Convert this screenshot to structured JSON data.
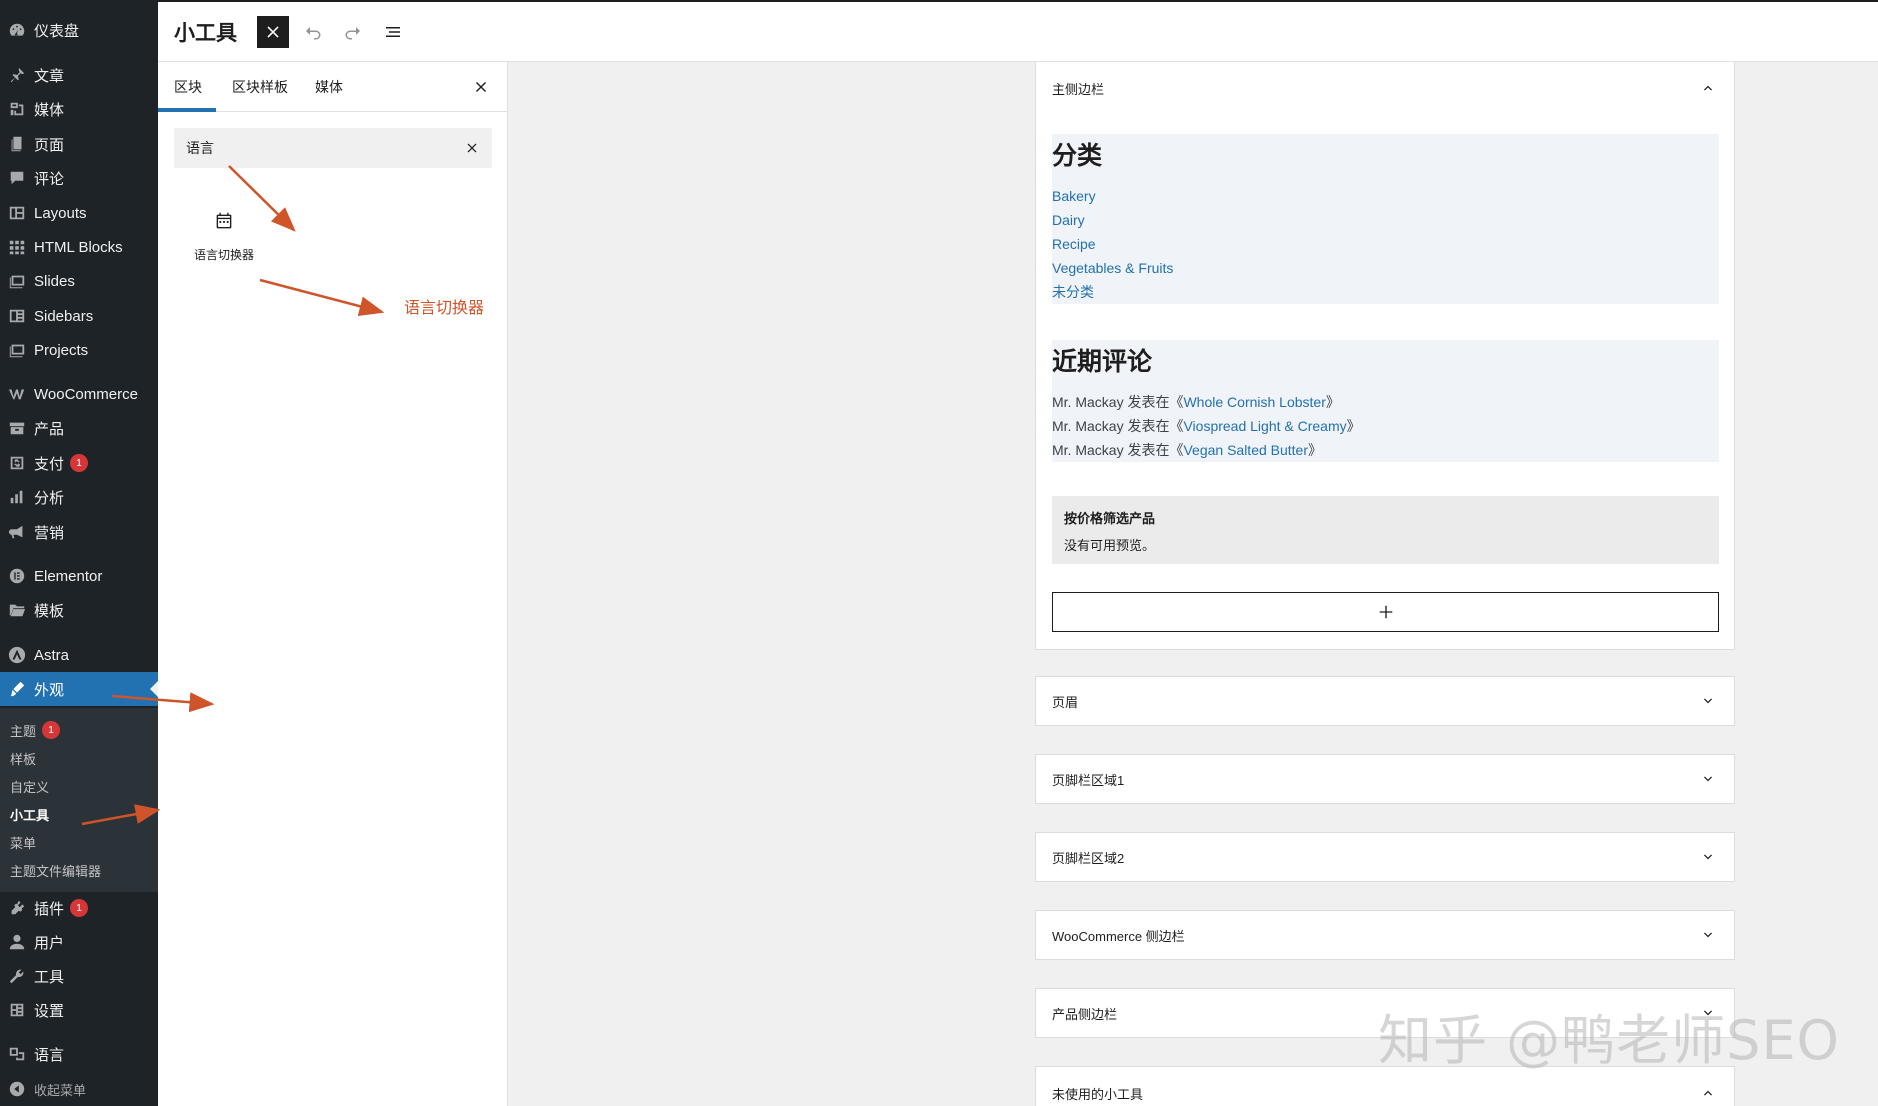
{
  "admin_menu": {
    "items": [
      {
        "key": "dashboard",
        "label": "仪表盘",
        "icon": "dashboard-icon"
      },
      {
        "key": "posts",
        "label": "文章",
        "icon": "pin-icon"
      },
      {
        "key": "media",
        "label": "媒体",
        "icon": "media-icon"
      },
      {
        "key": "pages",
        "label": "页面",
        "icon": "page-icon"
      },
      {
        "key": "comments",
        "label": "评论",
        "icon": "comment-icon"
      },
      {
        "key": "layouts",
        "label": "Layouts",
        "icon": "layouts-icon"
      },
      {
        "key": "html_blocks",
        "label": "HTML Blocks",
        "icon": "grid-icon"
      },
      {
        "key": "slides",
        "label": "Slides",
        "icon": "slides-icon"
      },
      {
        "key": "sidebars",
        "label": "Sidebars",
        "icon": "sidebars-icon"
      },
      {
        "key": "projects",
        "label": "Projects",
        "icon": "projects-icon"
      },
      {
        "key": "woocommerce",
        "label": "WooCommerce",
        "icon": "woocommerce-icon"
      },
      {
        "key": "products",
        "label": "产品",
        "icon": "archive-icon"
      },
      {
        "key": "payments",
        "label": "支付",
        "icon": "payment-icon",
        "badge": "1"
      },
      {
        "key": "analytics",
        "label": "分析",
        "icon": "chart-icon"
      },
      {
        "key": "marketing",
        "label": "营销",
        "icon": "megaphone-icon"
      },
      {
        "key": "elementor",
        "label": "Elementor",
        "icon": "elementor-icon"
      },
      {
        "key": "templates",
        "label": "模板",
        "icon": "folder-icon"
      },
      {
        "key": "astra",
        "label": "Astra",
        "icon": "astra-icon"
      },
      {
        "key": "appearance",
        "label": "外观",
        "icon": "brush-icon"
      },
      {
        "key": "plugins",
        "label": "插件",
        "icon": "plugin-icon",
        "badge": "1"
      },
      {
        "key": "users",
        "label": "用户",
        "icon": "user-icon"
      },
      {
        "key": "tools",
        "label": "工具",
        "icon": "wrench-icon"
      },
      {
        "key": "settings",
        "label": "设置",
        "icon": "settings-icon"
      },
      {
        "key": "languages",
        "label": "语言",
        "icon": "translation-icon"
      },
      {
        "key": "collapse",
        "label": "收起菜单",
        "icon": "collapse-icon"
      }
    ],
    "submenu": [
      {
        "label": "主题",
        "badge": "1"
      },
      {
        "label": "样板"
      },
      {
        "label": "自定义"
      },
      {
        "label": "小工具",
        "current": true
      },
      {
        "label": "菜单"
      },
      {
        "label": "主题文件编辑器"
      }
    ]
  },
  "header": {
    "title": "小工具",
    "buttons": [
      "close-icon",
      "undo-icon",
      "redo-icon",
      "list-view-icon"
    ]
  },
  "inserter": {
    "tabs": [
      "区块",
      "区块样板",
      "媒体"
    ],
    "active_tab": "区块",
    "search_value": "语言",
    "result_label": "语言切换器",
    "annotation": "语言切换器"
  },
  "widget_areas": {
    "main_sidebar": {
      "title": "主侧边栏",
      "expanded": true,
      "categories": {
        "heading": "分类",
        "items": [
          "Bakery",
          "Dairy",
          "Recipe",
          "Vegetables & Fruits",
          "未分类"
        ]
      },
      "recent_comments": {
        "heading": "近期评论",
        "items": [
          {
            "author": "Mr. Mackay",
            "verb": "发表在《",
            "post": "Whole Cornish Lobster",
            "close": "》"
          },
          {
            "author": "Mr. Mackay",
            "verb": "发表在《",
            "post": "Viospread Light & Creamy",
            "close": "》"
          },
          {
            "author": "Mr. Mackay",
            "verb": "发表在《",
            "post": "Vegan Salted Butter",
            "close": "》"
          }
        ]
      },
      "price_filter": {
        "title": "按价格筛选产品",
        "note": "没有可用预览。"
      }
    },
    "collapsed": [
      "页眉",
      "页脚栏区域1",
      "页脚栏区域2",
      "WooCommerce 侧边栏",
      "产品侧边栏"
    ],
    "inactive": {
      "title": "未使用的小工具",
      "expanded": true
    }
  },
  "watermark": "知乎 @鸭老师SEO",
  "colors": {
    "sidebar_bg": "#1d2327",
    "submenu_bg": "#2c3338",
    "accent": "#2271b1",
    "badge": "#d63638",
    "annotation": "#d0542a"
  }
}
